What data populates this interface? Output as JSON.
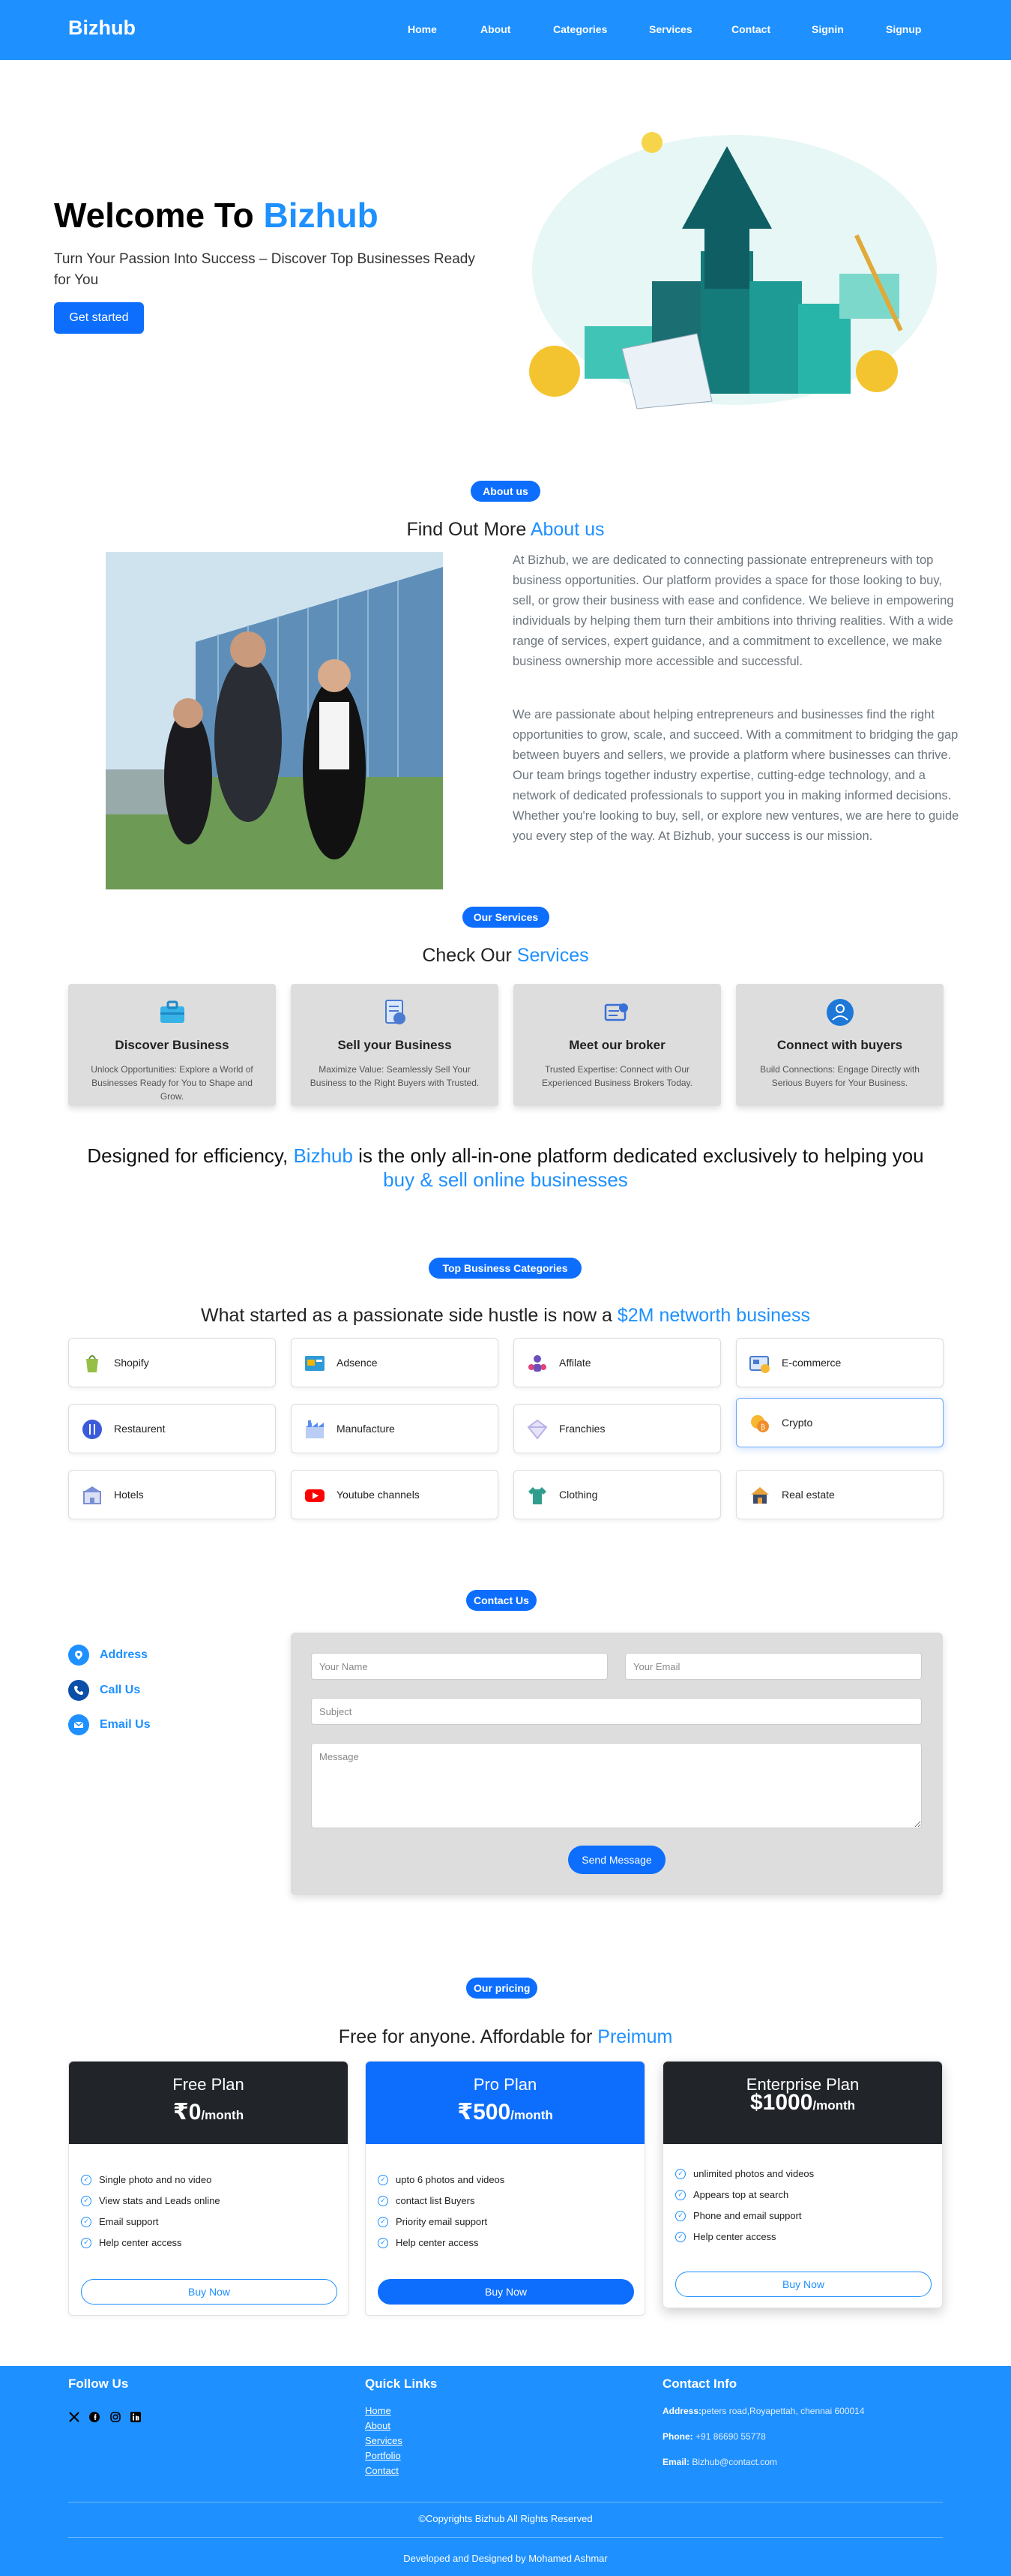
{
  "header": {
    "logo": "Bizhub",
    "nav": [
      "Home",
      "About",
      "Categories",
      "Services",
      "Contact",
      "Signin",
      "Signup"
    ]
  },
  "hero": {
    "title_prefix": "Welcome To ",
    "title_accent": "Bizhub",
    "subtitle": "Turn Your Passion Into Success – Discover Top Businesses Ready for You",
    "cta": "Get started"
  },
  "about": {
    "pill": "About us",
    "title_prefix": "Find Out More ",
    "title_accent": "About us",
    "para1": "At Bizhub, we are dedicated to connecting passionate entrepreneurs with top business opportunities. Our platform provides a space for those looking to buy, sell, or grow their business with ease and confidence. We believe in empowering individuals by helping them turn their ambitions into thriving realities. With a wide range of services, expert guidance, and a commitment to excellence, we make business ownership more accessible and successful.",
    "para2": "We are passionate about helping entrepreneurs and businesses find the right opportunities to grow, scale, and succeed. With a commitment to bridging the gap between buyers and sellers, we provide a platform where businesses can thrive. Our team brings together industry expertise, cutting-edge technology, and a network of dedicated professionals to support you in making informed decisions. Whether you're looking to buy, sell, or explore new ventures, we are here to guide you every step of the way. At Bizhub, your success is our mission."
  },
  "services": {
    "pill": "Our Services",
    "title_prefix": "Check Our ",
    "title_accent": "Services",
    "cards": [
      {
        "title": "Discover Business",
        "desc": "Unlock Opportunities: Explore a World of Businesses Ready for You to Shape and Grow.",
        "icon": "briefcase-icon"
      },
      {
        "title": "Sell your Business",
        "desc": "Maximize Value: Seamlessly Sell Your Business to the Right Buyers with Trusted.",
        "icon": "document-icon"
      },
      {
        "title": "Meet our broker",
        "desc": "Trusted Expertise: Connect with Our Experienced Business Brokers Today.",
        "icon": "broker-icon"
      },
      {
        "title": "Connect with buyers",
        "desc": "Build Connections: Engage Directly with Serious Buyers for Your Business.",
        "icon": "buyer-icon"
      }
    ]
  },
  "designed": {
    "part1": "Designed for efficiency, ",
    "accent1": "Bizhub",
    "part2": " is the only all-in-one platform dedicated exclusively to helping you",
    "accent2": "buy & sell online businesses"
  },
  "categories": {
    "pill": "Top Business Categories",
    "title_prefix": "What started as a passionate side hustle is now a ",
    "title_accent": "$2M networth business",
    "items": [
      {
        "label": "Shopify",
        "icon": "shopify-icon",
        "color": "#95bf47"
      },
      {
        "label": "Adsence",
        "icon": "adsense-icon",
        "color": "#2e9ad6"
      },
      {
        "label": "Affilate",
        "icon": "affiliate-icon",
        "color": "#6b4fbb"
      },
      {
        "label": "E-commerce",
        "icon": "ecommerce-icon",
        "color": "#4a7bd0"
      },
      {
        "label": "Restaurent",
        "icon": "restaurant-icon",
        "color": "#3b5bdb"
      },
      {
        "label": "Manufacture",
        "icon": "manufacture-icon",
        "color": "#5b8def"
      },
      {
        "label": "Franchies",
        "icon": "franchise-icon",
        "color": "#b8b3e8"
      },
      {
        "label": "Crypto",
        "icon": "crypto-icon",
        "color": "#f7b731"
      },
      {
        "label": "Hotels",
        "icon": "hotel-icon",
        "color": "#7a8fd6"
      },
      {
        "label": "Youtube channels",
        "icon": "youtube-icon",
        "color": "#ff0000"
      },
      {
        "label": "Clothing",
        "icon": "clothing-icon",
        "color": "#2f9e8f"
      },
      {
        "label": "Real estate",
        "icon": "realestate-icon",
        "color": "#e8a23a"
      }
    ]
  },
  "contact": {
    "pill": "Contact Us",
    "items": [
      {
        "label": "Address",
        "icon": "location-icon"
      },
      {
        "label": "Call Us",
        "icon": "phone-icon"
      },
      {
        "label": "Email Us",
        "icon": "email-icon"
      }
    ],
    "name_placeholder": "Your Name",
    "email_placeholder": "Your Email",
    "subject_placeholder": "Subject",
    "message_placeholder": "Message",
    "submit": "Send Message"
  },
  "pricing": {
    "pill": "Our pricing",
    "title_prefix": "Free for anyone. Affordable for ",
    "title_accent": "Preimum",
    "plans": [
      {
        "name": "Free Plan",
        "price": "₹0",
        "unit": "/month",
        "head_color": "#212529",
        "features": [
          "Single photo and no video",
          "View stats and Leads online",
          "Email support",
          "Help center access"
        ],
        "button": "Buy Now"
      },
      {
        "name": "Pro Plan",
        "price": "₹500",
        "unit": "/month",
        "head_color": "#0d6efd",
        "features": [
          "upto 6 photos and videos",
          "contact list Buyers",
          "Priority email support",
          "Help center access"
        ],
        "button": "Buy Now"
      },
      {
        "name": "Enterprise Plan",
        "price": "$1000",
        "unit": "/month",
        "head_color": "#212529",
        "features": [
          "unlimited photos and videos",
          "Appears top at search",
          "Phone and email support",
          "Help center access"
        ],
        "button": "Buy Now"
      }
    ]
  },
  "footer": {
    "follow_title": "Follow Us",
    "quick_title": "Quick Links",
    "links": [
      "Home",
      "About",
      "Services",
      "Portfolio",
      "Contact"
    ],
    "info_title": "Contact Info",
    "address_label": "Address:",
    "address": "peters road,Royapettah, chennai 600014",
    "phone_label": "Phone:",
    "phone": " +91 86690 55778",
    "email_label": "Email:",
    "email": " Bizhub@contact.com",
    "copyright": "©Copyrights Bizhub All Rights Reserved",
    "developed": "Developed and Designed by Mohamed Ashmar"
  }
}
